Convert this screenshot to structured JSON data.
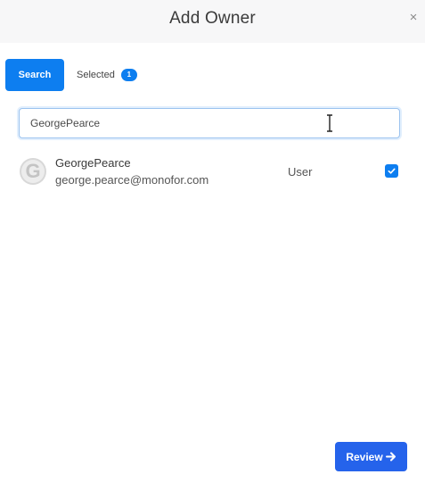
{
  "dialog": {
    "title": "Add Owner",
    "close_symbol": "×"
  },
  "tabs": {
    "search_label": "Search",
    "selected_label": "Selected",
    "selected_count": "1"
  },
  "search": {
    "value": "GeorgePearce"
  },
  "results": [
    {
      "avatar_letter": "G",
      "name": "GeorgePearce",
      "email": "george.pearce@monofor.com",
      "role": "User",
      "checked": true
    }
  ],
  "footer": {
    "review_label": "Review"
  },
  "colors": {
    "accent": "#0d7ef0",
    "review_button": "#2563eb",
    "header_bg": "#f7f7f8"
  },
  "icons": {
    "close": "close-icon",
    "cursor": "text-cursor-icon",
    "check": "check-icon",
    "arrow": "arrow-right-icon"
  }
}
